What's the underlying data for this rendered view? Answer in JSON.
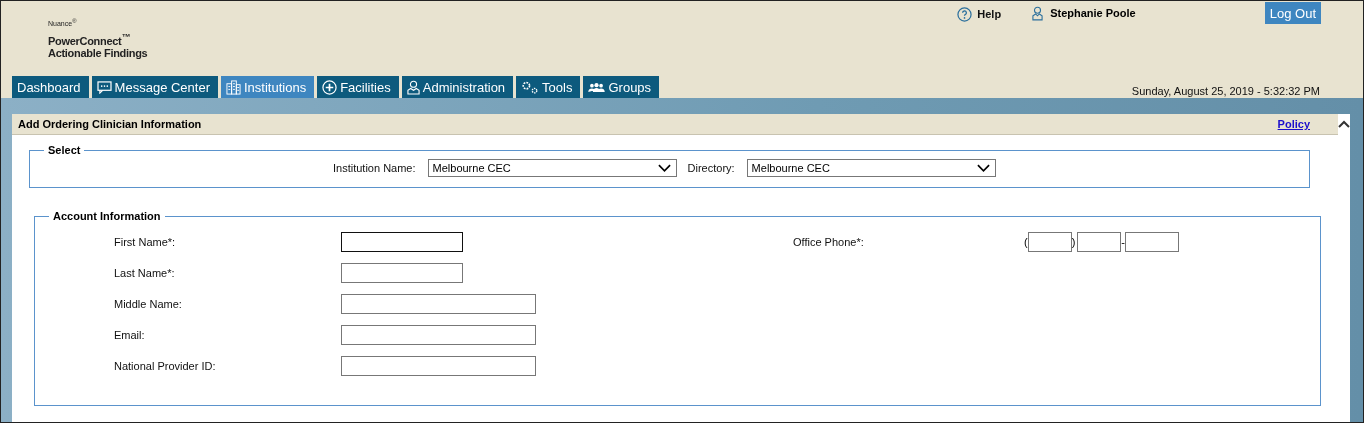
{
  "brand": {
    "company": "Nuance$^{®}$",
    "product": [
      "PowerConnect$^{™}$",
      "Actionable Findings"
    ]
  },
  "header": {
    "help": "Help",
    "user": "Stephanie Poole",
    "logout": "Log Out",
    "datetime": "Sunday, August 25, 2019 - 5:32:32 PM"
  },
  "tabs": [
    {
      "label": "Dashboard",
      "selected": false
    },
    {
      "label": "Message Center",
      "selected": false
    },
    {
      "label": "Institutions",
      "selected": true
    },
    {
      "label": "Facilities",
      "selected": false
    },
    {
      "label": "Administration",
      "selected": false
    },
    {
      "label": "Tools",
      "selected": false
    },
    {
      "label": "Groups",
      "selected": false
    }
  ],
  "panel": {
    "title": "Add Ordering Clinician Information",
    "link": "Policy"
  },
  "select_section": {
    "legend": "Select",
    "fields": [
      {
        "label": "Institution Name:",
        "value": "Melbourne CEC"
      },
      {
        "label": "Directory:",
        "value": "Melbourne CEC"
      }
    ]
  },
  "account_section": {
    "legend": "Account Information",
    "fields": [
      {
        "label": "First Name*:",
        "kind": "short"
      },
      {
        "label": "Last Name*:",
        "kind": "short"
      },
      {
        "label": "Middle Name:",
        "kind": "long"
      },
      {
        "label": "Email:",
        "kind": "long"
      },
      {
        "label": "National Provider ID:",
        "kind": "long"
      }
    ],
    "phone": {
      "label": "Office Phone*:",
      "open": "(",
      "close": ")",
      "dash": "-"
    }
  }
}
